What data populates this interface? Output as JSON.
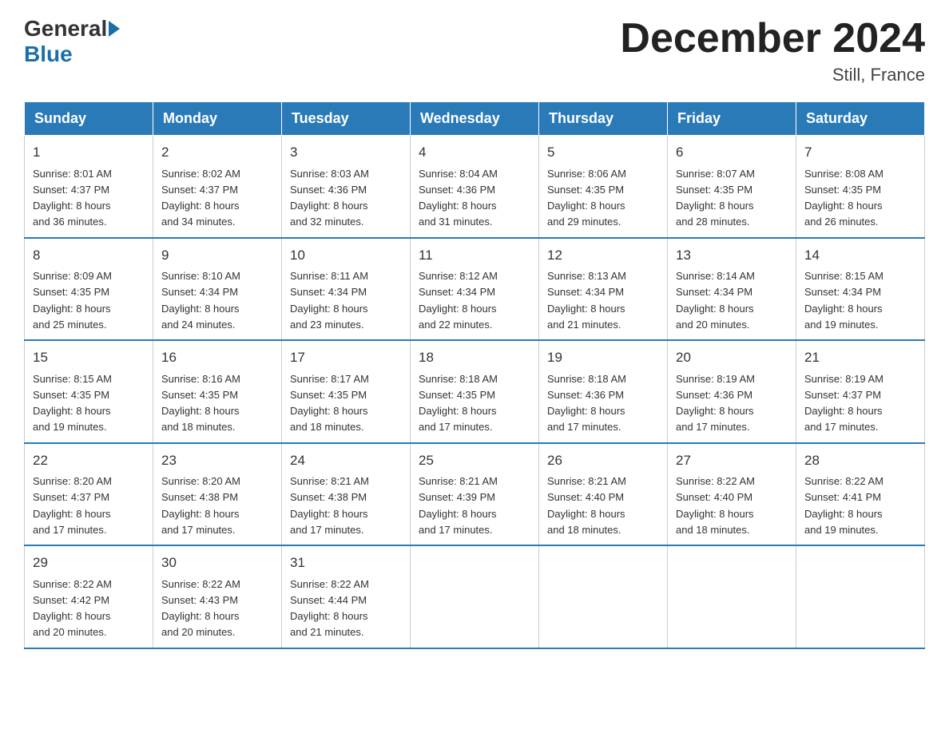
{
  "header": {
    "logo_general": "General",
    "logo_blue": "Blue",
    "month_year": "December 2024",
    "location": "Still, France"
  },
  "days_of_week": [
    "Sunday",
    "Monday",
    "Tuesday",
    "Wednesday",
    "Thursday",
    "Friday",
    "Saturday"
  ],
  "weeks": [
    [
      {
        "day": "1",
        "sunrise": "8:01 AM",
        "sunset": "4:37 PM",
        "daylight": "8 hours and 36 minutes."
      },
      {
        "day": "2",
        "sunrise": "8:02 AM",
        "sunset": "4:37 PM",
        "daylight": "8 hours and 34 minutes."
      },
      {
        "day": "3",
        "sunrise": "8:03 AM",
        "sunset": "4:36 PM",
        "daylight": "8 hours and 32 minutes."
      },
      {
        "day": "4",
        "sunrise": "8:04 AM",
        "sunset": "4:36 PM",
        "daylight": "8 hours and 31 minutes."
      },
      {
        "day": "5",
        "sunrise": "8:06 AM",
        "sunset": "4:35 PM",
        "daylight": "8 hours and 29 minutes."
      },
      {
        "day": "6",
        "sunrise": "8:07 AM",
        "sunset": "4:35 PM",
        "daylight": "8 hours and 28 minutes."
      },
      {
        "day": "7",
        "sunrise": "8:08 AM",
        "sunset": "4:35 PM",
        "daylight": "8 hours and 26 minutes."
      }
    ],
    [
      {
        "day": "8",
        "sunrise": "8:09 AM",
        "sunset": "4:35 PM",
        "daylight": "8 hours and 25 minutes."
      },
      {
        "day": "9",
        "sunrise": "8:10 AM",
        "sunset": "4:34 PM",
        "daylight": "8 hours and 24 minutes."
      },
      {
        "day": "10",
        "sunrise": "8:11 AM",
        "sunset": "4:34 PM",
        "daylight": "8 hours and 23 minutes."
      },
      {
        "day": "11",
        "sunrise": "8:12 AM",
        "sunset": "4:34 PM",
        "daylight": "8 hours and 22 minutes."
      },
      {
        "day": "12",
        "sunrise": "8:13 AM",
        "sunset": "4:34 PM",
        "daylight": "8 hours and 21 minutes."
      },
      {
        "day": "13",
        "sunrise": "8:14 AM",
        "sunset": "4:34 PM",
        "daylight": "8 hours and 20 minutes."
      },
      {
        "day": "14",
        "sunrise": "8:15 AM",
        "sunset": "4:34 PM",
        "daylight": "8 hours and 19 minutes."
      }
    ],
    [
      {
        "day": "15",
        "sunrise": "8:15 AM",
        "sunset": "4:35 PM",
        "daylight": "8 hours and 19 minutes."
      },
      {
        "day": "16",
        "sunrise": "8:16 AM",
        "sunset": "4:35 PM",
        "daylight": "8 hours and 18 minutes."
      },
      {
        "day": "17",
        "sunrise": "8:17 AM",
        "sunset": "4:35 PM",
        "daylight": "8 hours and 18 minutes."
      },
      {
        "day": "18",
        "sunrise": "8:18 AM",
        "sunset": "4:35 PM",
        "daylight": "8 hours and 17 minutes."
      },
      {
        "day": "19",
        "sunrise": "8:18 AM",
        "sunset": "4:36 PM",
        "daylight": "8 hours and 17 minutes."
      },
      {
        "day": "20",
        "sunrise": "8:19 AM",
        "sunset": "4:36 PM",
        "daylight": "8 hours and 17 minutes."
      },
      {
        "day": "21",
        "sunrise": "8:19 AM",
        "sunset": "4:37 PM",
        "daylight": "8 hours and 17 minutes."
      }
    ],
    [
      {
        "day": "22",
        "sunrise": "8:20 AM",
        "sunset": "4:37 PM",
        "daylight": "8 hours and 17 minutes."
      },
      {
        "day": "23",
        "sunrise": "8:20 AM",
        "sunset": "4:38 PM",
        "daylight": "8 hours and 17 minutes."
      },
      {
        "day": "24",
        "sunrise": "8:21 AM",
        "sunset": "4:38 PM",
        "daylight": "8 hours and 17 minutes."
      },
      {
        "day": "25",
        "sunrise": "8:21 AM",
        "sunset": "4:39 PM",
        "daylight": "8 hours and 17 minutes."
      },
      {
        "day": "26",
        "sunrise": "8:21 AM",
        "sunset": "4:40 PM",
        "daylight": "8 hours and 18 minutes."
      },
      {
        "day": "27",
        "sunrise": "8:22 AM",
        "sunset": "4:40 PM",
        "daylight": "8 hours and 18 minutes."
      },
      {
        "day": "28",
        "sunrise": "8:22 AM",
        "sunset": "4:41 PM",
        "daylight": "8 hours and 19 minutes."
      }
    ],
    [
      {
        "day": "29",
        "sunrise": "8:22 AM",
        "sunset": "4:42 PM",
        "daylight": "8 hours and 20 minutes."
      },
      {
        "day": "30",
        "sunrise": "8:22 AM",
        "sunset": "4:43 PM",
        "daylight": "8 hours and 20 minutes."
      },
      {
        "day": "31",
        "sunrise": "8:22 AM",
        "sunset": "4:44 PM",
        "daylight": "8 hours and 21 minutes."
      },
      null,
      null,
      null,
      null
    ]
  ],
  "labels": {
    "sunrise": "Sunrise:",
    "sunset": "Sunset:",
    "daylight": "Daylight:"
  }
}
